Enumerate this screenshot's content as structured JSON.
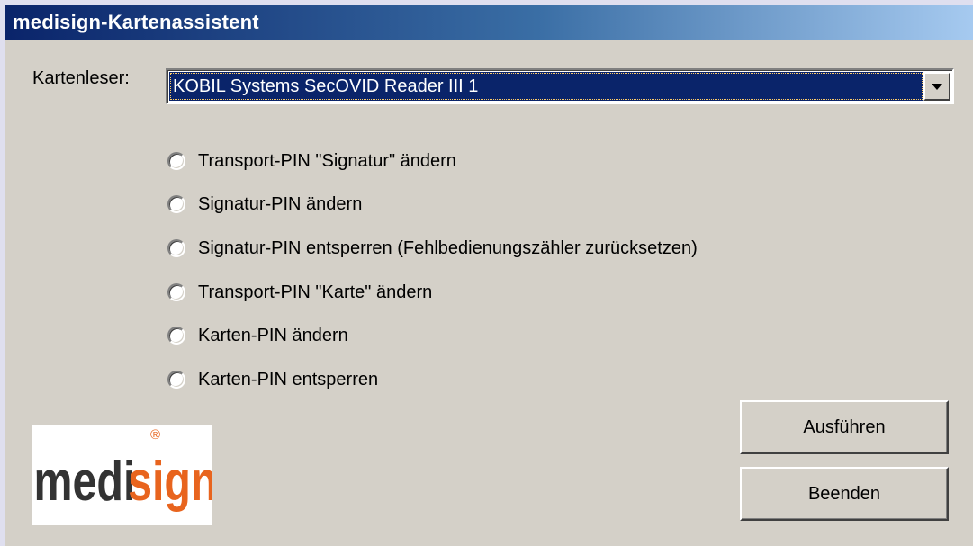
{
  "window": {
    "title": "medisign-Kartenassistent"
  },
  "reader": {
    "label": "Kartenleser:",
    "selected": "KOBIL Systems SecOVID Reader III 1"
  },
  "options": [
    {
      "label": "Transport-PIN \"Signatur\" ändern"
    },
    {
      "label": "Signatur-PIN ändern"
    },
    {
      "label": "Signatur-PIN entsperren (Fehlbedienungszähler zurücksetzen)"
    },
    {
      "label": "Transport-PIN \"Karte\" ändern"
    },
    {
      "label": "Karten-PIN ändern"
    },
    {
      "label": "Karten-PIN entsperren"
    }
  ],
  "buttons": {
    "execute": "Ausführen",
    "quit": "Beenden"
  },
  "logo": {
    "text_part1": "medi",
    "text_part2": "sign",
    "registered": "®",
    "color_part1": "#333333",
    "color_part2": "#e8641e"
  },
  "colors": {
    "titlebar_start": "#0a246a",
    "titlebar_end": "#a6caf0",
    "selection": "#0a246a"
  }
}
